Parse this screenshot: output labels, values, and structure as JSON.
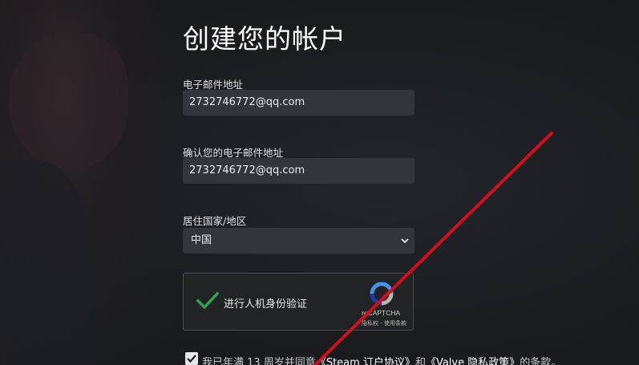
{
  "page": {
    "title": "创建您的帐户"
  },
  "email": {
    "label": "电子邮件地址",
    "value": "2732746772@qq.com"
  },
  "confirm_email": {
    "label": "确认您的电子邮件地址",
    "value": "2732746772@qq.com"
  },
  "country": {
    "label": "居住国家/地区",
    "selected": "中国"
  },
  "captcha": {
    "label": "进行人机身份验证",
    "brand": "reCAPTCHA",
    "terms": "隐私权 - 使用条款",
    "checked": true
  },
  "agreement": {
    "prefix": "我已年满 13 周岁并同意",
    "link1": "《Steam 订户协议》",
    "conj": "和",
    "link2": "《Valve 隐私政策》",
    "suffix": "的条款。",
    "checked": true
  },
  "colors": {
    "annotation_red": "#d0101a",
    "check_green": "#2ea44f",
    "recaptcha_blue": "#4a90e2"
  }
}
